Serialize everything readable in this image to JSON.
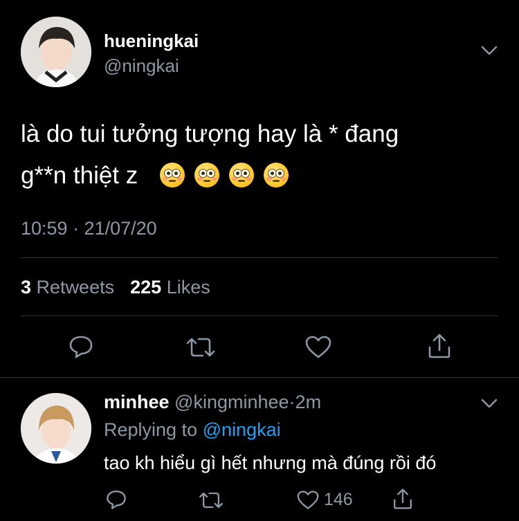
{
  "main_tweet": {
    "display_name": "hueningkai",
    "handle": "@ningkai",
    "text_line1": "là do tui tưởng tượng hay là * đang",
    "text_line2": "g**n thiệt z",
    "emojis": [
      "flushed-face-emoji",
      "flushed-face-emoji",
      "flushed-face-emoji",
      "flushed-face-emoji"
    ],
    "timestamp": "10:59 · 21/07/20",
    "retweets_count": "3",
    "retweets_label": "Retweets",
    "likes_count": "225",
    "likes_label": "Likes"
  },
  "reply": {
    "display_name": "minhee",
    "handle": "@kingminhee",
    "separator": "·",
    "time": "2m",
    "replying_to_label": "Replying to",
    "replying_to_handle": "@ningkai",
    "text": "tao kh hiểu gì hết nhưng mà đúng rồi đó",
    "likes_count": "146"
  },
  "colors": {
    "background": "#000000",
    "text": "#ffffff",
    "muted": "#8b98a5",
    "link": "#1da1f2",
    "divider": "#2f3336"
  }
}
